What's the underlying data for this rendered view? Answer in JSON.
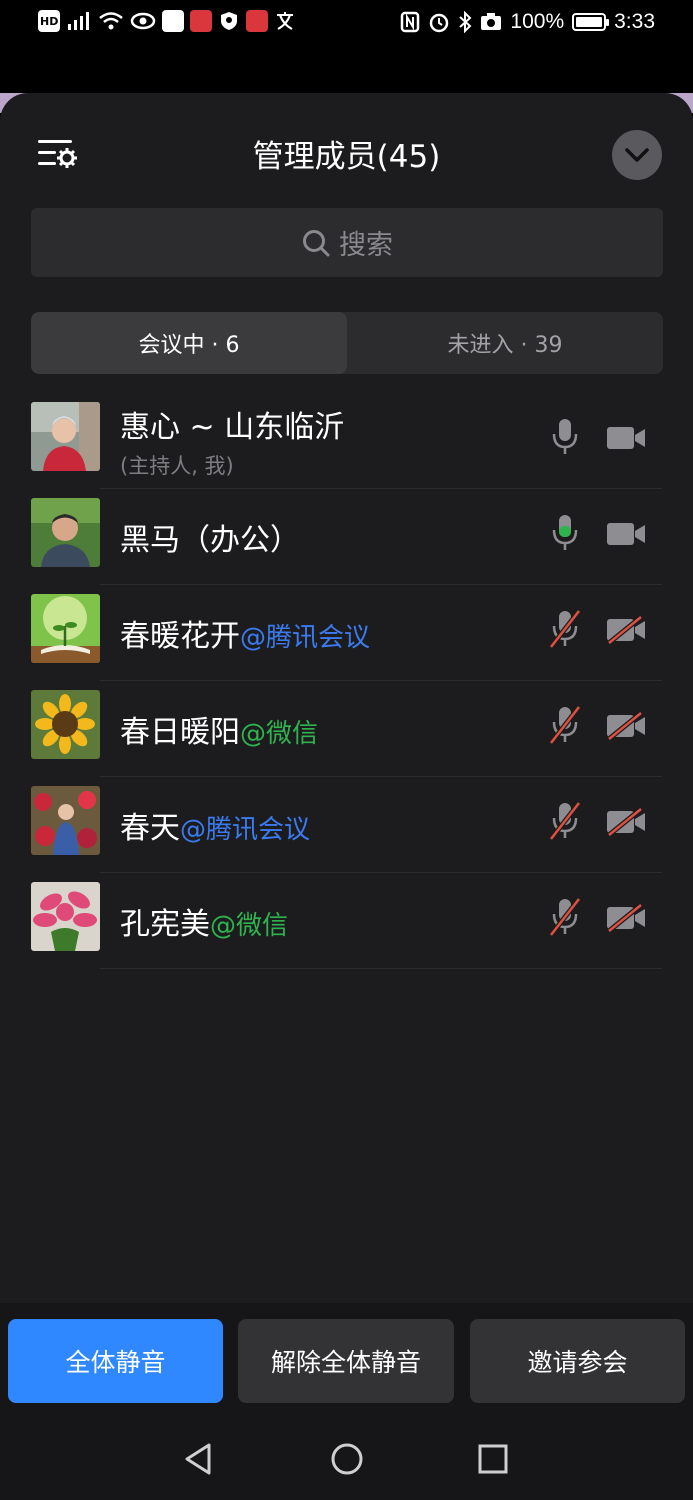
{
  "status_bar": {
    "left_icons": [
      "hd-icon",
      "4g-signal-icon",
      "wifi-icon",
      "eye-icon",
      "qq-icon",
      "app-icon",
      "shield-icon",
      "app-icon",
      "translate-icon"
    ],
    "hd_label": "HD",
    "battery_percent": "100%",
    "time": "3:33"
  },
  "header": {
    "title": "管理成员(45)"
  },
  "search": {
    "placeholder": "搜索"
  },
  "tabs": [
    {
      "label": "会议中 · 6",
      "active": true
    },
    {
      "label": "未进入 · 39",
      "active": false
    }
  ],
  "members": [
    {
      "name": "惠心 ~ 山东临沂",
      "source": "",
      "role": "(主持人, 我)",
      "mic": "on",
      "camera": "off-icon-gray"
    },
    {
      "name": "黑马（办公）",
      "source": "",
      "role": "",
      "mic": "speaking",
      "camera": "off-icon-gray"
    },
    {
      "name": "春暖花开",
      "source": "@腾讯会议",
      "role": "",
      "mic": "muted",
      "camera": "disabled"
    },
    {
      "name": "春日暖阳",
      "source": "@微信",
      "role": "",
      "mic": "muted",
      "camera": "disabled"
    },
    {
      "name": "春天",
      "source": "@腾讯会议",
      "role": "",
      "mic": "muted",
      "camera": "disabled"
    },
    {
      "name": "孔宪美",
      "source": "@微信",
      "role": "",
      "mic": "muted",
      "camera": "disabled"
    }
  ],
  "actions": {
    "mute_all": "全体静音",
    "unmute_all": "解除全体静音",
    "invite": "邀请参会"
  },
  "colors": {
    "primary": "#2f88ff",
    "tencent_source": "#3a7bf0",
    "wechat_source": "#2fb34f",
    "speaking_mic": "#2fb34f",
    "muted_slash": "#e0503e"
  }
}
